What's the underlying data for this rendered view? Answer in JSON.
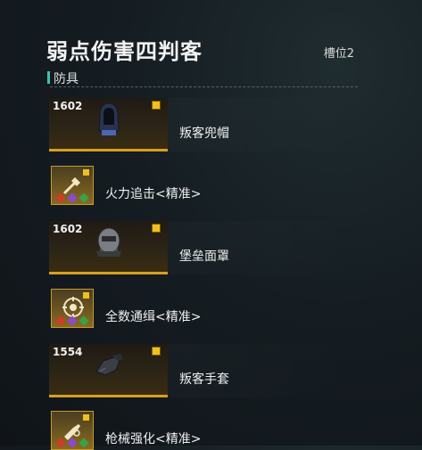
{
  "header": {
    "title": "弱点伤害四判客",
    "slot_label": "槽位2"
  },
  "section": {
    "label": "防具"
  },
  "items": [
    {
      "power": "1602",
      "name": "叛客兜帽",
      "icon": "hood-icon",
      "talent": "火力追击<精准>",
      "talent_icon": "reload-talent-icon"
    },
    {
      "power": "1602",
      "name": "堡垒面罩",
      "icon": "mask-icon",
      "talent": "全数通缉<精准>",
      "talent_icon": "target-talent-icon"
    },
    {
      "power": "1554",
      "name": "叛客手套",
      "icon": "gloves-icon",
      "talent": "枪械强化<精准>",
      "talent_icon": "gun-talent-icon"
    }
  ],
  "colors": {
    "accent": "#3fc0b0",
    "gear_gold": "#d8a020"
  }
}
